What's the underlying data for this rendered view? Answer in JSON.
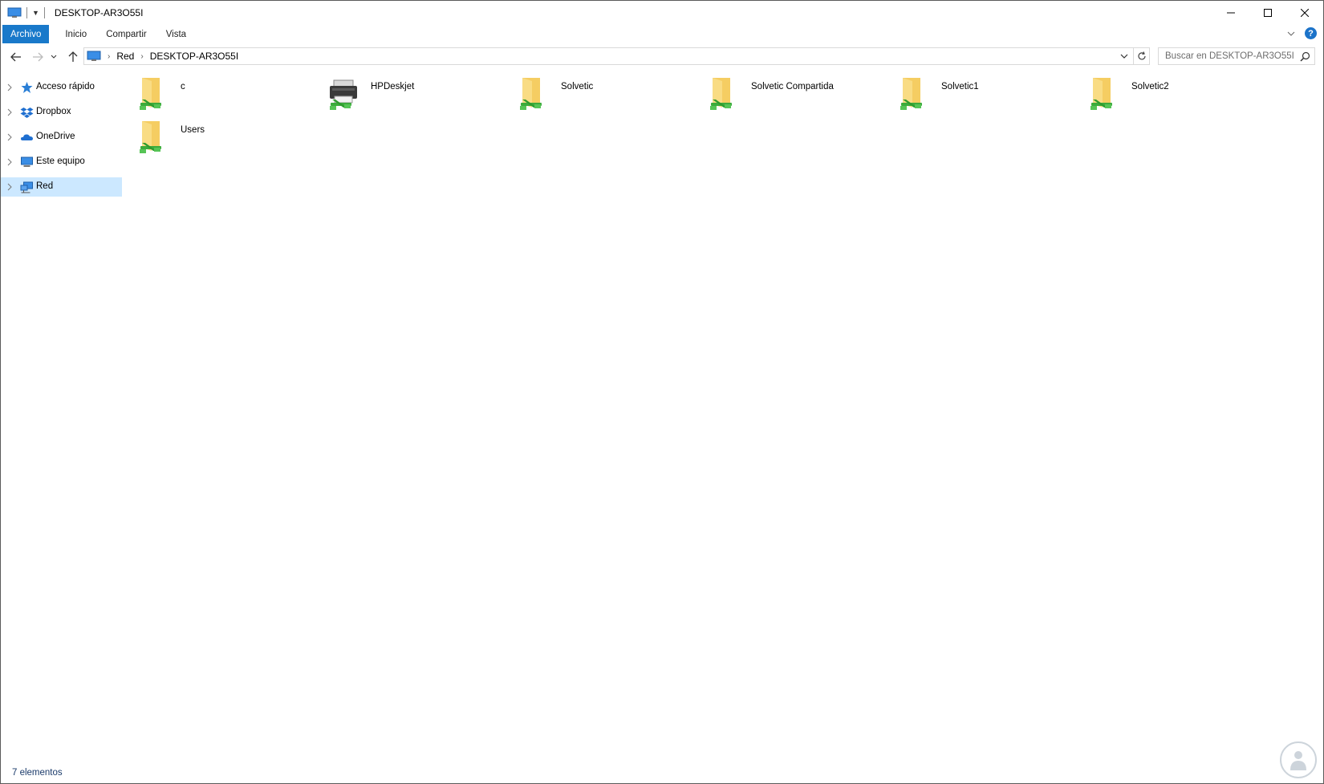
{
  "window": {
    "title": "DESKTOP-AR3O55I"
  },
  "ribbon": {
    "tabs": [
      "Archivo",
      "Inicio",
      "Compartir",
      "Vista"
    ]
  },
  "address": {
    "breadcrumb": [
      "Red",
      "DESKTOP-AR3O55I"
    ],
    "search_placeholder": "Buscar en DESKTOP-AR3O55I"
  },
  "nav": {
    "items": [
      {
        "label": "Acceso rápido",
        "icon": "star-icon"
      },
      {
        "label": "Dropbox",
        "icon": "dropbox-icon"
      },
      {
        "label": "OneDrive",
        "icon": "cloud-icon"
      },
      {
        "label": "Este equipo",
        "icon": "computer-icon"
      },
      {
        "label": "Red",
        "icon": "network-icon",
        "selected": true
      }
    ]
  },
  "items": [
    {
      "label": "c",
      "icon": "network-share-folder-icon"
    },
    {
      "label": "HPDeskjet",
      "icon": "network-printer-icon"
    },
    {
      "label": "Solvetic",
      "icon": "network-share-folder-icon"
    },
    {
      "label": "Solvetic Compartida",
      "icon": "network-share-folder-icon"
    },
    {
      "label": "Solvetic1",
      "icon": "network-share-folder-icon"
    },
    {
      "label": "Solvetic2",
      "icon": "network-share-folder-icon"
    },
    {
      "label": "Users",
      "icon": "network-share-folder-icon"
    }
  ],
  "status": {
    "count_text": "7 elementos"
  },
  "colors": {
    "file_tab": "#1979ca",
    "selection": "#cce8ff",
    "folder": "#f5cd62",
    "share_arrow": "#3cab3c"
  }
}
